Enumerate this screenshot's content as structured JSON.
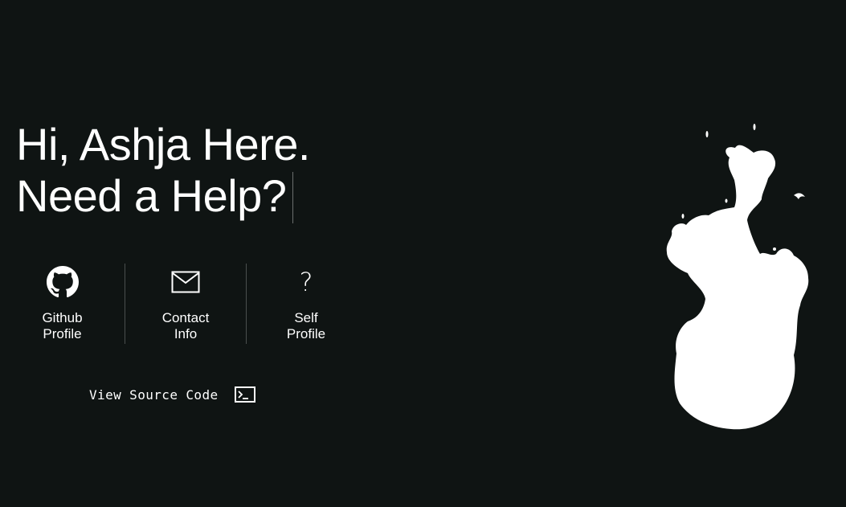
{
  "hero": {
    "line1": "Hi, Ashja Here.",
    "line2": "Need a Help?"
  },
  "links": [
    {
      "icon": "github-icon",
      "label_line1": "Github",
      "label_line2": "Profile"
    },
    {
      "icon": "mail-icon",
      "label_line1": "Contact",
      "label_line2": "Info"
    },
    {
      "icon": "question-icon",
      "label_line1": "Self",
      "label_line2": "Profile",
      "glyph": "?"
    }
  ],
  "source": {
    "label": "View Source Code",
    "icon": "terminal-icon"
  },
  "colors": {
    "background": "#0f1413",
    "foreground": "#ffffff",
    "divider": "#4a4f4e"
  },
  "decoration": {
    "icon": "ink-blob-illustration"
  }
}
